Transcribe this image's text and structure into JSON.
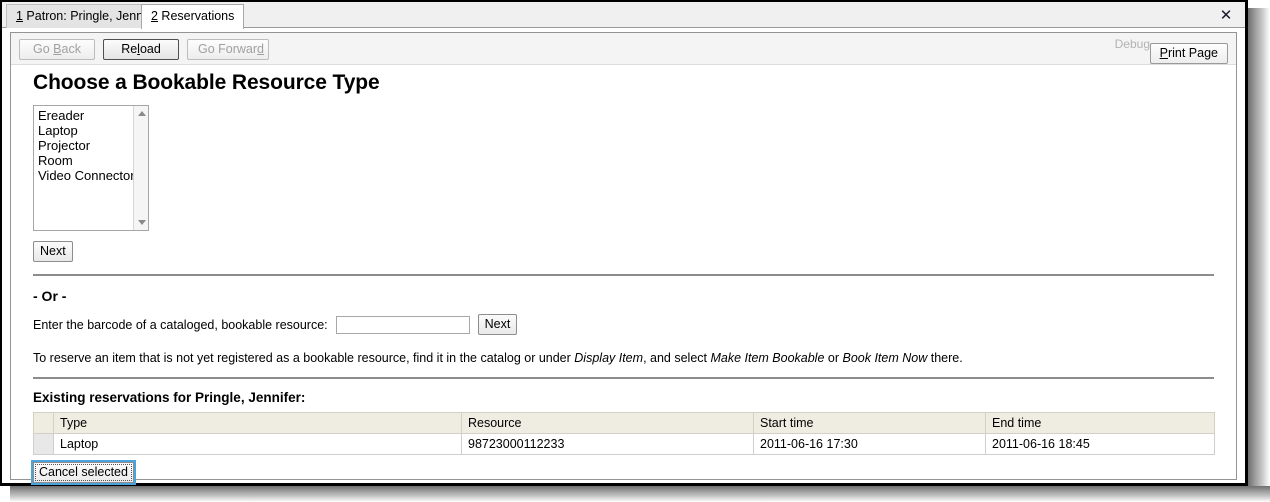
{
  "window": {
    "close_icon": "✕",
    "tabs": [
      {
        "number": "1",
        "label": " Patron: Pringle, Jennifer",
        "active": false
      },
      {
        "number": "2",
        "label": " Reservations",
        "active": true
      }
    ]
  },
  "toolbar": {
    "go_back": {
      "pre": "Go ",
      "accel": "B",
      "post": "ack"
    },
    "reload": {
      "pre": "Re",
      "accel": "l",
      "post": "oad"
    },
    "go_forward": {
      "pre": "Go Forwar",
      "accel": "d",
      "post": ""
    },
    "debug_label": "Debug",
    "print_page": {
      "pre": "",
      "accel": "P",
      "post": "rint Page"
    }
  },
  "page": {
    "title": "Choose a Bookable Resource Type",
    "resource_types": [
      "Ereader",
      "Laptop",
      "Projector",
      "Room",
      "Video Connector"
    ],
    "next_type_button": "Next",
    "or_divider": "- Or -",
    "barcode_label": "Enter the barcode of a cataloged, bookable resource:",
    "barcode_value": "",
    "barcode_placeholder": "",
    "next_barcode_button": "Next",
    "hint": {
      "part1": "To reserve an item that is not yet registered as a bookable resource, find it in the catalog or under ",
      "em1": "Display Item",
      "part2": ", and select ",
      "em2": "Make Item Bookable",
      "part3": " or ",
      "em3": "Book Item Now",
      "part4": " there."
    },
    "existing_title": "Existing reservations for Pringle, Jennifer:",
    "table": {
      "columns": [
        "Type",
        "Resource",
        "Start time",
        "End time"
      ],
      "rows": [
        {
          "type": "Laptop",
          "resource": "98723000112233",
          "start_time": "2011-06-16 17:30",
          "end_time": "2011-06-16 18:45"
        }
      ]
    },
    "cancel_selected_button": "Cancel selected"
  },
  "colors": {
    "focus_ring": "#4ba3dd",
    "table_header_bg": "#efede2",
    "rule": "#8c8c8c"
  }
}
